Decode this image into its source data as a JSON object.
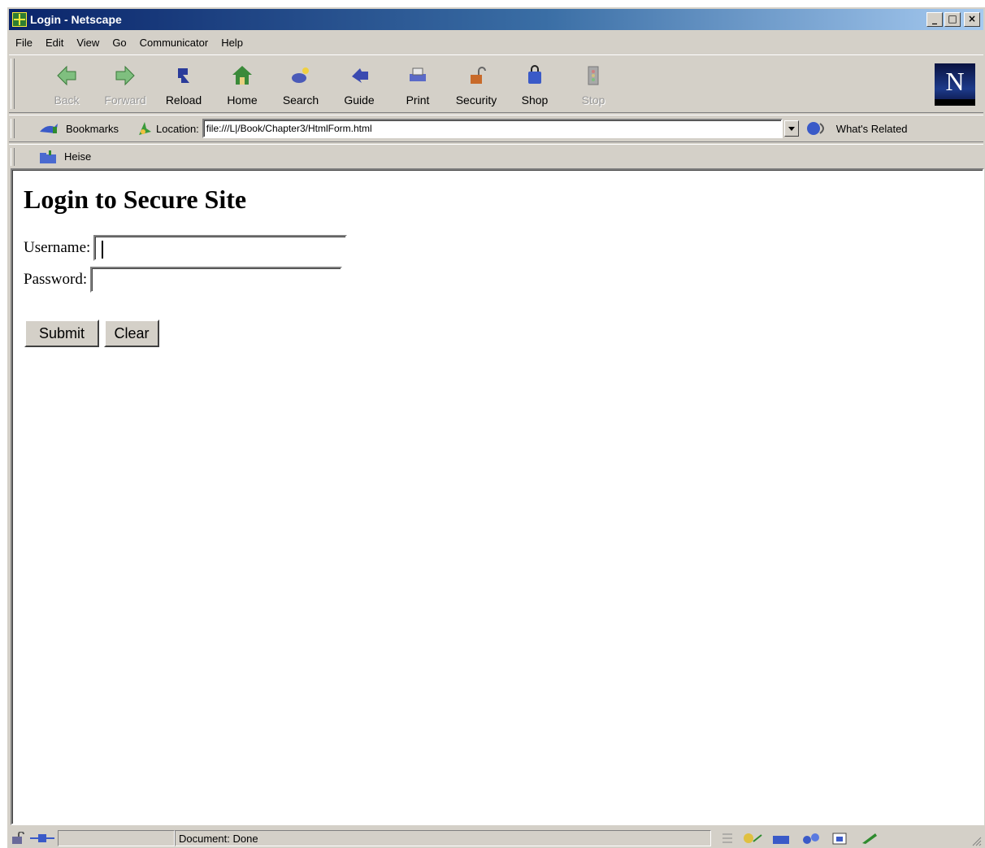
{
  "window": {
    "title": "Login - Netscape"
  },
  "menu": [
    "File",
    "Edit",
    "View",
    "Go",
    "Communicator",
    "Help"
  ],
  "toolbar": {
    "buttons": [
      {
        "label": "Back",
        "icon": "back-arrow-icon",
        "enabled": false
      },
      {
        "label": "Forward",
        "icon": "forward-arrow-icon",
        "enabled": false
      },
      {
        "label": "Reload",
        "icon": "reload-icon",
        "enabled": true
      },
      {
        "label": "Home",
        "icon": "home-icon",
        "enabled": true
      },
      {
        "label": "Search",
        "icon": "search-icon",
        "enabled": true
      },
      {
        "label": "Guide",
        "icon": "guide-icon",
        "enabled": true
      },
      {
        "label": "Print",
        "icon": "print-icon",
        "enabled": true
      },
      {
        "label": "Security",
        "icon": "security-lock-icon",
        "enabled": true
      },
      {
        "label": "Shop",
        "icon": "shop-bag-icon",
        "enabled": true
      },
      {
        "label": "Stop",
        "icon": "stop-icon",
        "enabled": false
      }
    ]
  },
  "location_bar": {
    "bookmarks_label": "Bookmarks",
    "location_label": "Location:",
    "url": "file:///L|/Book/Chapter3/HtmlForm.html",
    "whats_related_label": "What's Related"
  },
  "personal_toolbar": {
    "item_label": "Heise"
  },
  "page": {
    "heading": "Login to Secure Site",
    "username_label": "Username:",
    "username_value": "",
    "password_label": "Password:",
    "password_value": "",
    "submit_label": "Submit",
    "clear_label": "Clear"
  },
  "status": {
    "text": "Document: Done"
  },
  "colors": {
    "titlebar_start": "#0a246a",
    "titlebar_end": "#a6caf0",
    "chrome": "#d4d0c8"
  }
}
